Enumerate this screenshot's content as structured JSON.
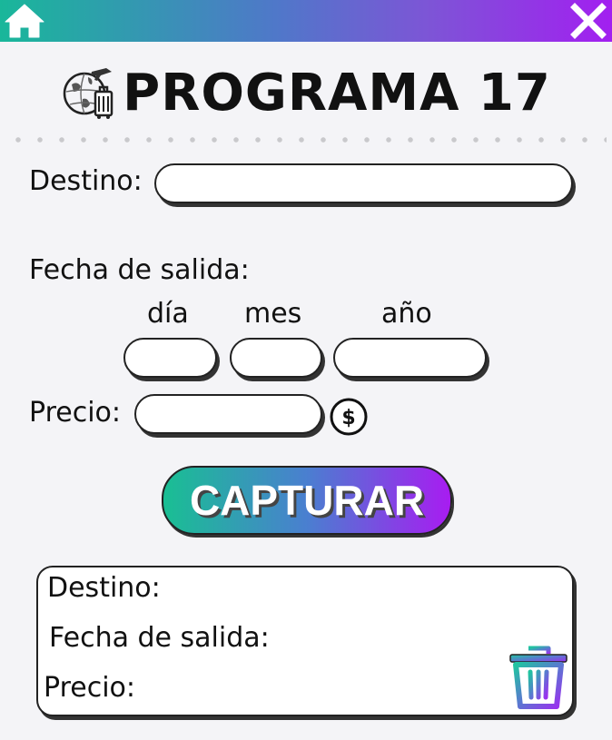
{
  "header": {
    "home_icon": "home-icon",
    "close_icon": "close-icon",
    "gradient_start": "#19b79a",
    "gradient_end": "#a21ff0"
  },
  "title": {
    "text": "PROGRAMA 17",
    "icon": "travel-globe-luggage-icon"
  },
  "form": {
    "destino_label": "Destino:",
    "destino_value": "",
    "fecha_label": "Fecha de salida:",
    "dia_label": "día",
    "mes_label": "mes",
    "anio_label": "año",
    "dia_value": "",
    "mes_value": "",
    "anio_value": "",
    "precio_label": "Precio:",
    "precio_value": "",
    "currency_icon": "dollar-coin-icon"
  },
  "capture_button": {
    "label": "CAPTURAR"
  },
  "result": {
    "destino_label": "Destino:",
    "fecha_label": "Fecha de salida:",
    "precio_label": "Precio:",
    "delete_icon": "trash-icon"
  }
}
